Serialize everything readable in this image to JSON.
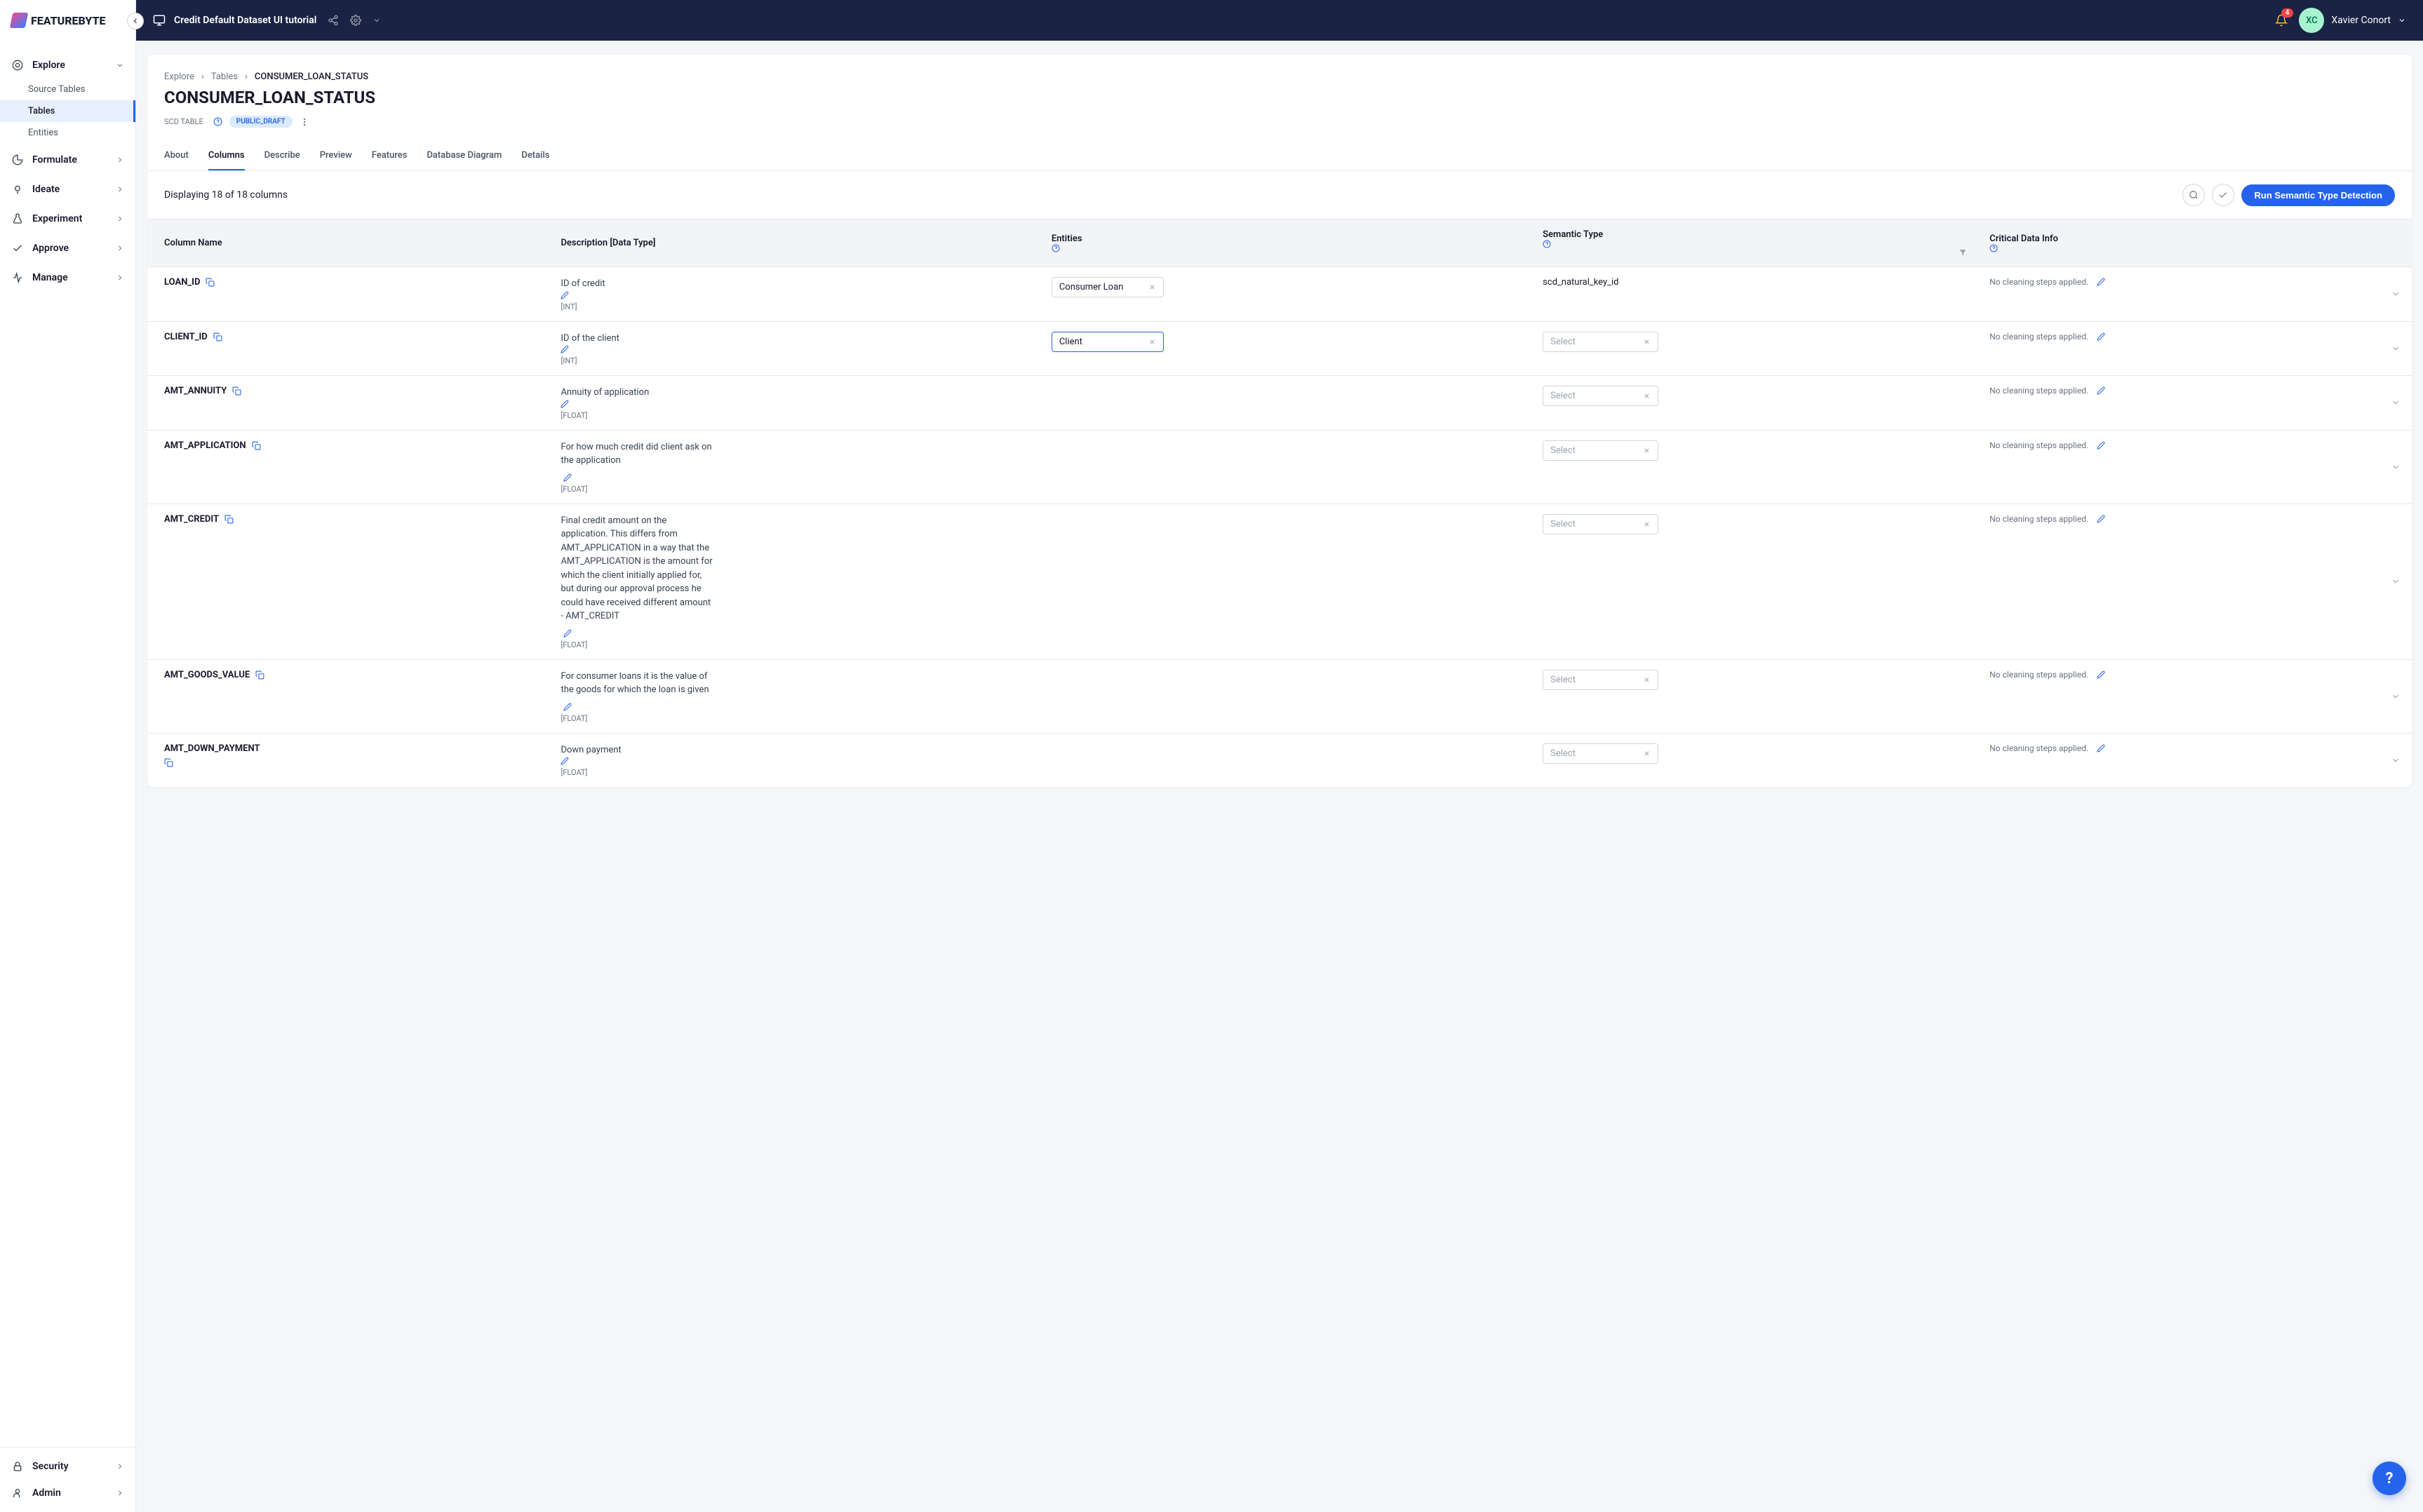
{
  "brand": "FEATUREBYTE",
  "header": {
    "project": "Credit Default Dataset UI tutorial",
    "user_name": "Xavier Conort",
    "user_initials": "XC",
    "notif_count": "4"
  },
  "sidebar": {
    "sections": [
      {
        "label": "Explore",
        "expanded": true,
        "items": [
          "Source Tables",
          "Tables",
          "Entities"
        ],
        "active_index": 1
      },
      {
        "label": "Formulate"
      },
      {
        "label": "Ideate"
      },
      {
        "label": "Experiment"
      },
      {
        "label": "Approve"
      },
      {
        "label": "Manage"
      }
    ],
    "bottom": [
      {
        "label": "Security"
      },
      {
        "label": "Admin"
      }
    ]
  },
  "breadcrumb": [
    "Explore",
    "Tables",
    "CONSUMER_LOAN_STATUS"
  ],
  "page_title": "CONSUMER_LOAN_STATUS",
  "meta": {
    "table_type": "SCD TABLE",
    "status_badge": "PUBLIC_DRAFT"
  },
  "tabs": [
    "About",
    "Columns",
    "Describe",
    "Preview",
    "Features",
    "Database Diagram",
    "Details"
  ],
  "active_tab_index": 1,
  "toolbar": {
    "display_text": "Displaying 18 of 18 columns",
    "run_button": "Run Semantic Type Detection"
  },
  "table": {
    "headers": {
      "colname": "Column Name",
      "desc": "Description [Data Type]",
      "entities": "Entities",
      "semantic": "Semantic Type",
      "cdi": "Critical Data Info"
    },
    "select_placeholder": "Select",
    "no_cleaning": "No cleaning steps applied.",
    "rows": [
      {
        "name": "LOAN_ID",
        "desc": "ID of credit",
        "dtype": "[INT]",
        "entity": "Consumer Loan",
        "semantic": "scd_natural_key_id"
      },
      {
        "name": "CLIENT_ID",
        "desc": "ID of the client",
        "dtype": "[INT]",
        "entity": "Client",
        "entity_highlight": true,
        "semantic_select": true
      },
      {
        "name": "AMT_ANNUITY",
        "desc": "Annuity of application",
        "dtype": "[FLOAT]",
        "semantic_select": true
      },
      {
        "name": "AMT_APPLICATION",
        "desc": "For how much credit did client ask on the application",
        "dtype": "[FLOAT]",
        "semantic_select": true,
        "edit_below": true
      },
      {
        "name": "AMT_CREDIT",
        "desc": "Final credit amount on the application. This differs from AMT_APPLICATION in a way that the AMT_APPLICATION is the amount for which the client initially applied for, but during our approval process he could have received different amount - AMT_CREDIT",
        "dtype": "[FLOAT]",
        "semantic_select": true,
        "edit_below": true
      },
      {
        "name": "AMT_GOODS_VALUE",
        "desc": "For consumer loans it is the value of the goods for which the loan is given",
        "dtype": "[FLOAT]",
        "semantic_select": true,
        "edit_below": true
      },
      {
        "name": "AMT_DOWN_PAYMENT",
        "desc": "Down payment",
        "dtype": "[FLOAT]",
        "semantic_select": true,
        "copy_below": true
      }
    ]
  }
}
